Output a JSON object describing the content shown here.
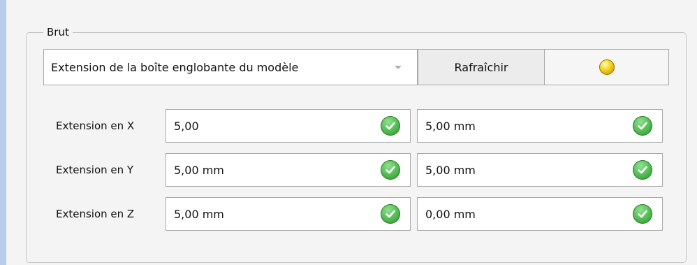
{
  "group": {
    "title": "Brut"
  },
  "stock_mode": {
    "selected": "Extension de la boîte englobante du modèle"
  },
  "buttons": {
    "refresh_label": "Rafraîchir"
  },
  "status_indicator": {
    "color": "#f2cf1d"
  },
  "rows": [
    {
      "label": "Extension en X",
      "value1": "5,00",
      "value2": "5,00 mm"
    },
    {
      "label": "Extension en Y",
      "value1": "5,00 mm",
      "value2": "5,00 mm"
    },
    {
      "label": "Extension en Z",
      "value1": "5,00 mm",
      "value2": "0,00 mm"
    }
  ],
  "icons": {
    "valid": "check-circle-icon",
    "dropdown": "chevron-down-icon",
    "status": "status-dot-icon"
  }
}
